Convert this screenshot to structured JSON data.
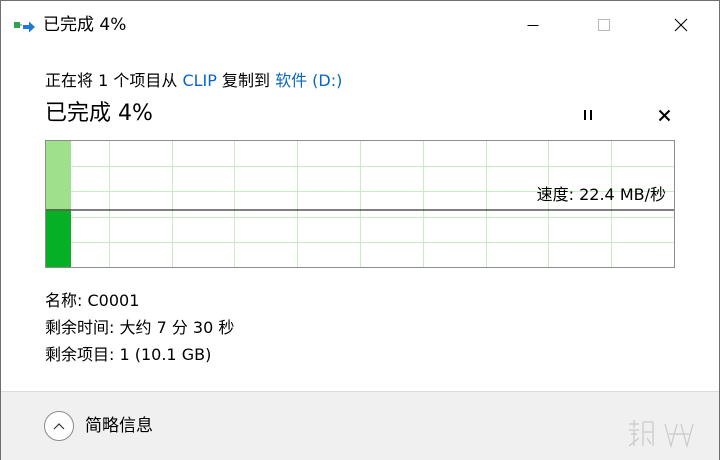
{
  "window": {
    "title": "已完成 4%",
    "icon": "file-copy-icon"
  },
  "copy": {
    "prefix": "正在将 1 个项目从 ",
    "source": "CLIP",
    "middle": " 复制到 ",
    "destination": "软件 (D:)"
  },
  "progress": {
    "title": "已完成 4%",
    "percent": 4,
    "speed_label": "速度: 22.4 MB/秒"
  },
  "details": {
    "name": "名称: C0001",
    "time_remaining": "剩余时间: 大约 7 分 30 秒",
    "items_remaining": "剩余项目: 1 (10.1 GB)"
  },
  "footer": {
    "toggle_label": "简略信息"
  },
  "colors": {
    "accent_link": "#0a66c2",
    "progress_dark": "#06b025",
    "progress_light": "#9fe08d",
    "grid": "#c9ecc4"
  }
}
